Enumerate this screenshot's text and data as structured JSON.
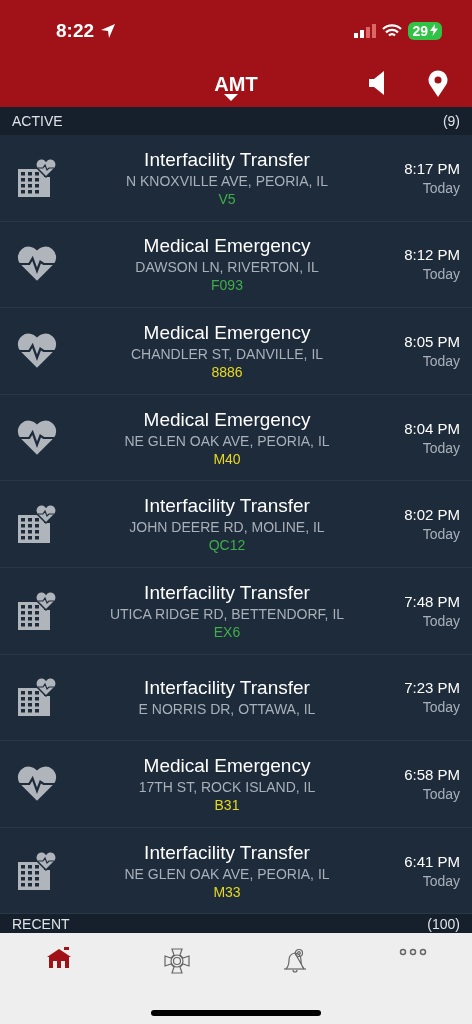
{
  "status_bar": {
    "time": "8:22",
    "battery": "29"
  },
  "nav": {
    "title": "AMT"
  },
  "sections": [
    {
      "title": "ACTIVE",
      "count": "(9)"
    },
    {
      "title": "RECENT",
      "count": "(100)"
    }
  ],
  "incidents": [
    {
      "kind": "transfer",
      "title": "Interfacility Transfer",
      "address": "N KNOXVILLE AVE, PEORIA, IL",
      "code": "V5",
      "color": "#3fae49",
      "time": "8:17 PM",
      "day": "Today"
    },
    {
      "kind": "medical",
      "title": "Medical Emergency",
      "address": "DAWSON LN, RIVERTON, IL",
      "code": "F093",
      "color": "#3fae49",
      "time": "8:12 PM",
      "day": "Today"
    },
    {
      "kind": "medical",
      "title": "Medical Emergency",
      "address": "CHANDLER ST, DANVILLE, IL",
      "code": "8886",
      "color": "#e8d81c",
      "time": "8:05 PM",
      "day": "Today"
    },
    {
      "kind": "medical",
      "title": "Medical Emergency",
      "address": "NE GLEN OAK AVE, PEORIA, IL",
      "code": "M40",
      "color": "#e8d81c",
      "time": "8:04 PM",
      "day": "Today"
    },
    {
      "kind": "transfer",
      "title": "Interfacility Transfer",
      "address": "JOHN DEERE RD, MOLINE, IL",
      "code": "QC12",
      "color": "#3fae49",
      "time": "8:02 PM",
      "day": "Today"
    },
    {
      "kind": "transfer",
      "title": "Interfacility Transfer",
      "address": "UTICA RIDGE RD, BETTENDORF, IL",
      "code": "EX6",
      "color": "#3fae49",
      "time": "7:48 PM",
      "day": "Today"
    },
    {
      "kind": "transfer",
      "title": "Interfacility Transfer",
      "address": "E NORRIS DR, OTTAWA, IL",
      "time": "7:23 PM",
      "day": "Today"
    },
    {
      "kind": "medical",
      "title": "Medical Emergency",
      "address": "17TH ST, ROCK ISLAND, IL",
      "code": "B31",
      "color": "#e8d81c",
      "time": "6:58 PM",
      "day": "Today"
    },
    {
      "kind": "transfer",
      "title": "Interfacility Transfer",
      "address": "NE GLEN OAK AVE, PEORIA, IL",
      "code": "M33",
      "color": "#e8d81c",
      "time": "6:41 PM",
      "day": "Today"
    }
  ],
  "tab_bar": [
    {
      "kind": "home",
      "selected": true
    },
    {
      "kind": "badge",
      "selected": false
    },
    {
      "kind": "alert",
      "selected": false
    },
    {
      "kind": "more",
      "selected": false
    }
  ]
}
